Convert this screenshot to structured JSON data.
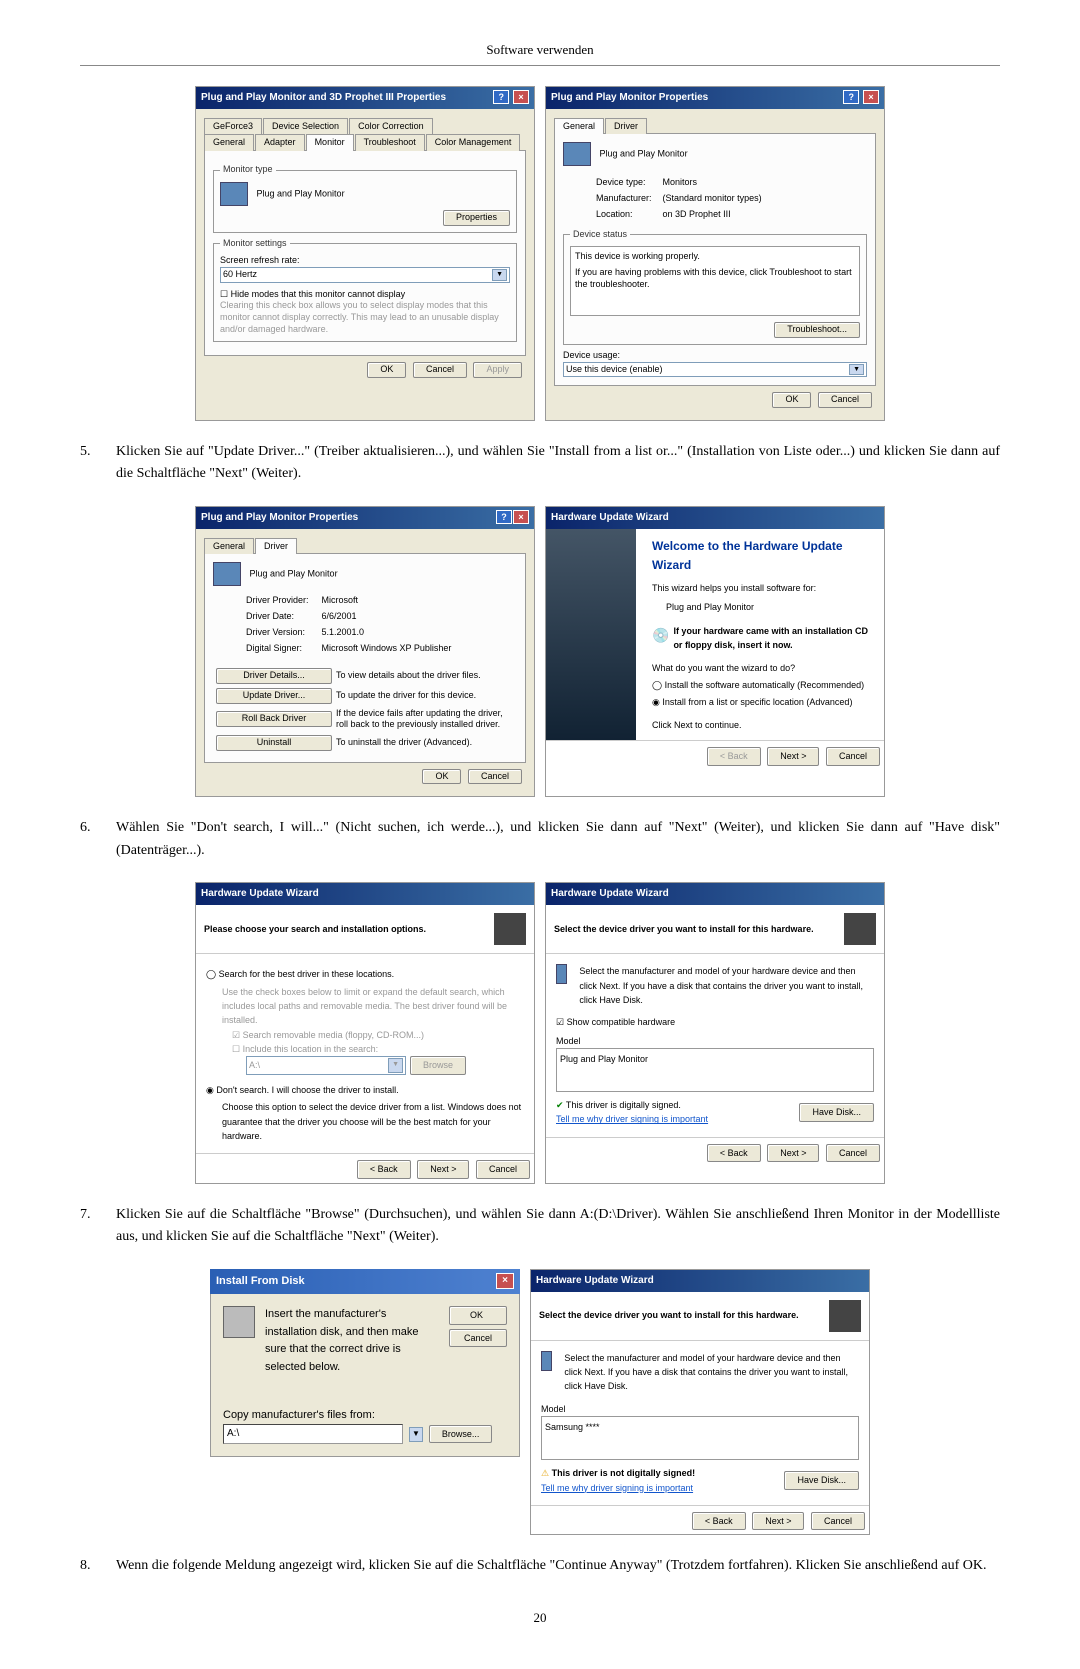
{
  "page": {
    "header": "Software verwenden",
    "pagenum": "20"
  },
  "step5": {
    "num": "5.",
    "text": "Klicken Sie auf \"Update Driver...\" (Treiber aktualisieren...), und wählen Sie \"Install from a list or...\" (Installation von Liste oder...) und klicken Sie dann auf die Schaltfläche \"Next\" (Weiter)."
  },
  "step6": {
    "num": "6.",
    "text": "Wählen Sie \"Don't search, I will...\" (Nicht suchen, ich werde...), und klicken Sie dann auf \"Next\" (Weiter), und klicken Sie dann auf \"Have disk\" (Datenträger...)."
  },
  "step7": {
    "num": "7.",
    "text": "Klicken Sie auf die Schaltfläche \"Browse\" (Durchsuchen), und wählen Sie dann A:(D:\\Driver). Wählen Sie anschließend Ihren Monitor in der Modellliste aus, und klicken Sie auf die Schaltfläche \"Next\" (Weiter)."
  },
  "step8": {
    "num": "8.",
    "text": "Wenn die folgende Meldung angezeigt wird, klicken Sie auf die Schaltfläche \"Continue Anyway\" (Trotzdem fortfahren). Klicken Sie anschließend auf OK."
  },
  "dlgA": {
    "title": "Plug and Play Monitor and 3D Prophet III Properties",
    "tabs_row1": [
      "GeForce3",
      "Device Selection",
      "Color Correction"
    ],
    "tabs_row2": [
      "General",
      "Adapter",
      "Monitor",
      "Troubleshoot",
      "Color Management"
    ],
    "montype_legend": "Monitor type",
    "montype_text": "Plug and Play Monitor",
    "properties_btn": "Properties",
    "settings_legend": "Monitor settings",
    "refresh_label": "Screen refresh rate:",
    "refresh_value": "60 Hertz",
    "hide_check": "Hide modes that this monitor cannot display",
    "hide_desc": "Clearing this check box allows you to select display modes that this monitor cannot display correctly. This may lead to an unusable display and/or damaged hardware.",
    "ok": "OK",
    "cancel": "Cancel",
    "apply": "Apply"
  },
  "dlgB": {
    "title": "Plug and Play Monitor Properties",
    "tab_general": "General",
    "tab_driver": "Driver",
    "header": "Plug and Play Monitor",
    "devtype_l": "Device type:",
    "devtype_v": "Monitors",
    "mfr_l": "Manufacturer:",
    "mfr_v": "(Standard monitor types)",
    "loc_l": "Location:",
    "loc_v": "on 3D Prophet III",
    "status_legend": "Device status",
    "status_l1": "This device is working properly.",
    "status_l2": "If you are having problems with this device, click Troubleshoot to start the troubleshooter.",
    "trouble_btn": "Troubleshoot...",
    "usage_l": "Device usage:",
    "usage_v": "Use this device (enable)",
    "ok": "OK",
    "cancel": "Cancel"
  },
  "dlgC": {
    "title": "Plug and Play Monitor Properties",
    "tab_general": "General",
    "tab_driver": "Driver",
    "header": "Plug and Play Monitor",
    "provider_l": "Driver Provider:",
    "provider_v": "Microsoft",
    "date_l": "Driver Date:",
    "date_v": "6/6/2001",
    "version_l": "Driver Version:",
    "version_v": "5.1.2001.0",
    "signer_l": "Digital Signer:",
    "signer_v": "Microsoft Windows XP Publisher",
    "details_btn": "Driver Details...",
    "details_txt": "To view details about the driver files.",
    "update_btn": "Update Driver...",
    "update_txt": "To update the driver for this device.",
    "rollback_btn": "Roll Back Driver",
    "rollback_txt": "If the device fails after updating the driver, roll back to the previously installed driver.",
    "uninstall_btn": "Uninstall",
    "uninstall_txt": "To uninstall the driver (Advanced).",
    "ok": "OK",
    "cancel": "Cancel"
  },
  "dlgD": {
    "title": "Hardware Update Wizard",
    "welcome": "Welcome to the Hardware Update Wizard",
    "helps": "This wizard helps you install software for:",
    "device": "Plug and Play Monitor",
    "cd_hint": "If your hardware came with an installation CD or floppy disk, insert it now.",
    "what": "What do you want the wizard to do?",
    "opt1": "Install the software automatically (Recommended)",
    "opt2": "Install from a list or specific location (Advanced)",
    "continue": "Click Next to continue.",
    "back": "< Back",
    "next": "Next >",
    "cancel": "Cancel"
  },
  "dlgE": {
    "title": "Hardware Update Wizard",
    "banner": "Please choose your search and installation options.",
    "opt1": "Search for the best driver in these locations.",
    "opt1_desc": "Use the check boxes below to limit or expand the default search, which includes local paths and removable media. The best driver found will be installed.",
    "sub1": "Search removable media (floppy, CD-ROM...)",
    "sub2": "Include this location in the search:",
    "path": "A:\\",
    "browse": "Browse",
    "opt2": "Don't search. I will choose the driver to install.",
    "opt2_desc": "Choose this option to select the device driver from a list. Windows does not guarantee that the driver you choose will be the best match for your hardware.",
    "back": "< Back",
    "next": "Next >",
    "cancel": "Cancel"
  },
  "dlgF": {
    "title": "Hardware Update Wizard",
    "banner": "Select the device driver you want to install for this hardware.",
    "desc": "Select the manufacturer and model of your hardware device and then click Next. If you have a disk that contains the driver you want to install, click Have Disk.",
    "show_compat": "Show compatible hardware",
    "model_l": "Model",
    "model_v": "Plug and Play Monitor",
    "signed": "This driver is digitally signed.",
    "tell_link": "Tell me why driver signing is important",
    "have_disk": "Have Disk...",
    "back": "< Back",
    "next": "Next >",
    "cancel": "Cancel"
  },
  "dlgG": {
    "title": "Install From Disk",
    "msg": "Insert the manufacturer's installation disk, and then make sure that the correct drive is selected below.",
    "ok": "OK",
    "cancel": "Cancel",
    "copy_l": "Copy manufacturer's files from:",
    "path": "A:\\",
    "browse": "Browse..."
  },
  "dlgH": {
    "title": "Hardware Update Wizard",
    "banner": "Select the device driver you want to install for this hardware.",
    "desc": "Select the manufacturer and model of your hardware device and then click Next. If you have a disk that contains the driver you want to install, click Have Disk.",
    "model_l": "Model",
    "model_v": "Samsung ****",
    "notsigned": "This driver is not digitally signed!",
    "tell_link": "Tell me why driver signing is important",
    "have_disk": "Have Disk...",
    "back": "< Back",
    "next": "Next >",
    "cancel": "Cancel"
  }
}
